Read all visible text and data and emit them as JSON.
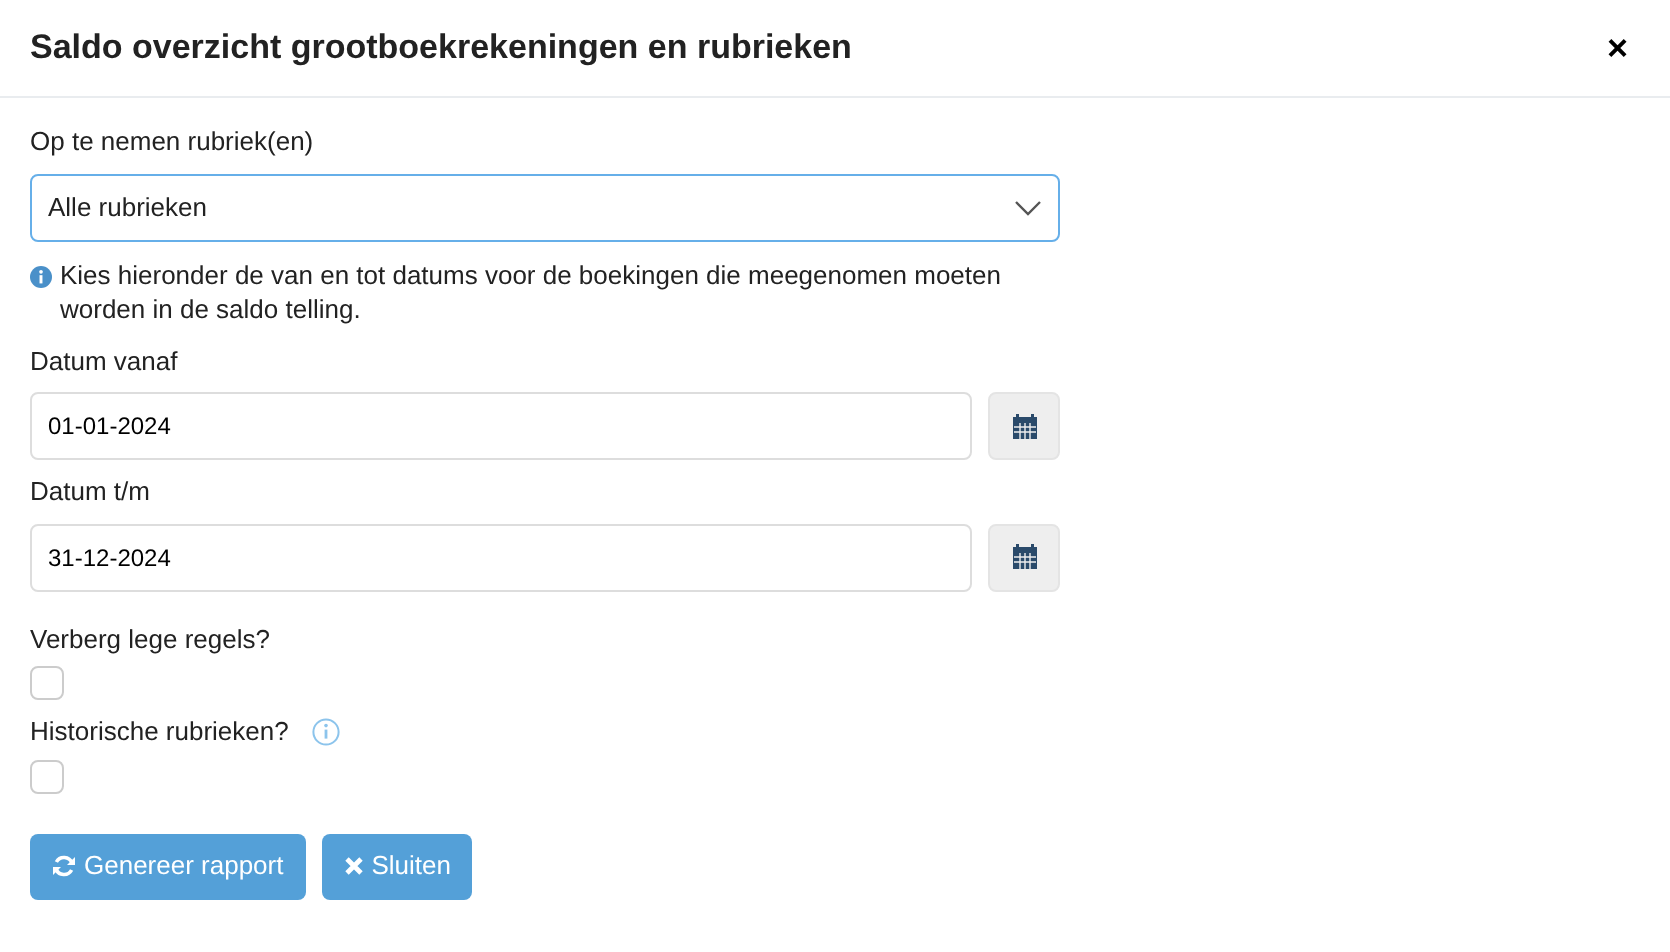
{
  "window": {
    "title": "Saldo overzicht grootboekrekeningen en rubrieken",
    "close": "×"
  },
  "rubriek": {
    "label": "Op te nemen rubriek(en)",
    "value": "Alle rubrieken"
  },
  "info": "Kies hieronder de van en tot datums voor de boekingen die meegenomen moeten worden in de saldo telling.",
  "dates": [
    {
      "label": "Datum vanaf",
      "value": "01-01-2024"
    },
    {
      "label": "Datum t/m",
      "value": "31-12-2024"
    }
  ],
  "checks": [
    {
      "label": "Verberg lege regels?",
      "checked": false,
      "info": false
    },
    {
      "label": "Historische rubrieken?",
      "checked": false,
      "info": true
    }
  ],
  "buttons": [
    {
      "kind": "refresh",
      "label": "Genereer rapport"
    },
    {
      "kind": "close",
      "label": "Sluiten"
    }
  ]
}
